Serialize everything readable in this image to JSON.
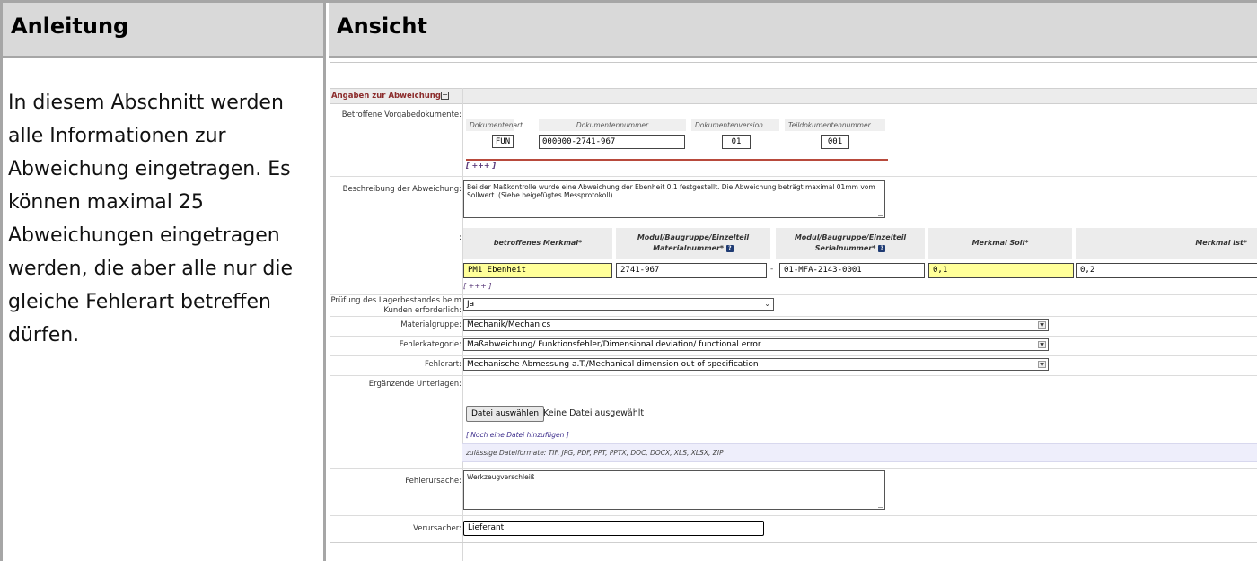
{
  "headers": {
    "left": "Anleitung",
    "right": "Ansicht"
  },
  "instruction": "In diesem Abschnitt werden alle Informationen zur Abweichung eingetragen. Es können maximal 25 Abweichungen eingetragen werden, die aber alle nur die gleiche Fehlerart betreffen dürfen.",
  "section": {
    "title": "Angaben zur Abweichung",
    "toggle": "−"
  },
  "labels": {
    "vorgabe": "Betroffene Vorgabedokumente:",
    "beschreibung": "Beschreibung der Abweichung:",
    "merkmale": ":",
    "lager_1": "Prüfung des Lagerbestandes beim",
    "lager_2": "Kunden erforderlich:",
    "materialgruppe": "Materialgruppe:",
    "fehlerkategorie": "Fehlerkategorie:",
    "fehlerart": "Fehlerart:",
    "unterlagen": "Ergänzende Unterlagen:",
    "ursache": "Fehlerursache:",
    "verursacher": "Verursacher:"
  },
  "documents": {
    "col_art": "Dokumentenart",
    "col_nummer": "Dokumentennummer",
    "col_version": "Dokumentenversion",
    "col_teil": "Teildokumentennummer",
    "art": "FUN",
    "nummer": "000000-2741-967",
    "version": "01",
    "teil": "001",
    "add": "[ +++ ]"
  },
  "beschreibung": "Bei der Maßkontrolle wurde eine Abweichung der Ebenheit 0,1 festgestellt. Die Abweichung beträgt maximal 01mm vom Sollwert. (Siehe beigefügtes Messprotokoll)",
  "merkmal_table": {
    "h_merkmal": "betroffenes Merkmal*",
    "h_material_1": "Modul/Baugruppe/Einzelteil",
    "h_material_2": "Materialnummer*",
    "h_serial_1": "Modul/Baugruppe/Einzelteil",
    "h_serial_2": "Serialnummer*",
    "h_soll": "Merkmal Soll*",
    "h_ist": "Merkmal Ist*",
    "help": "?",
    "merkmal": "PM1 Ebenheit",
    "materialnummer": "2741-967",
    "dash": "-",
    "serialnummer": "01-MFA-2143-0001",
    "soll": "0,1",
    "ist": "0,2",
    "add": "[ +++ ]"
  },
  "lager": "Ja",
  "materialgruppe": "Mechanik/Mechanics",
  "fehlerkategorie": "Maßabweichung/ Funktionsfehler/Dimensional deviation/ functional error",
  "fehlerart": "Mechanische Abmessung a.T./Mechanical dimension out of specification",
  "upload": {
    "button": "Datei auswählen",
    "status": "Keine Datei ausgewählt",
    "add_link": "[ Noch eine Datei hinzufügen ]",
    "formats": "zulässige Dateiformate: TIF, JPG, PDF, PPT, PPTX, DOC, DOCX, XLS, XLSX, ZIP"
  },
  "fehlerursache": "Werkzeugverschleiß",
  "verursacher": "Lieferant"
}
